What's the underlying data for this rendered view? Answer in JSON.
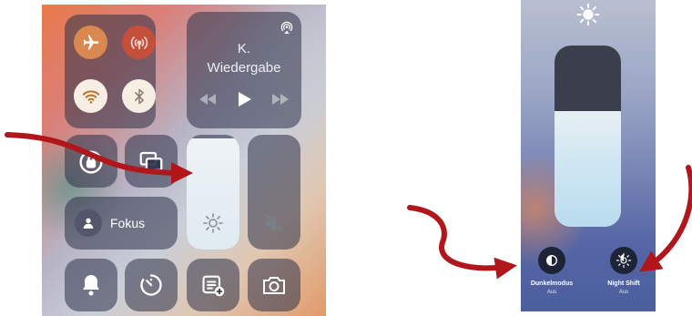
{
  "left_panel": {
    "connectivity": {
      "airplane": "airplane-icon",
      "cellular": "cellular-icon",
      "wifi": "wifi-icon",
      "bluetooth": "bluetooth-icon"
    },
    "media": {
      "title_line1": "K.",
      "title_line2": "Wiedergabe",
      "airplay_icon": "airplay-icon"
    },
    "focus_label": "Fokus",
    "brightness_level": 0.97,
    "volume_level": 0.0
  },
  "right_panel": {
    "brightness_level": 0.64,
    "dark_mode": {
      "label": "Dunkelmodus",
      "status": "Aus"
    },
    "night_shift": {
      "label": "Night Shift",
      "status": "Aus"
    }
  },
  "colors": {
    "arrow": "#b0161a",
    "accent_orange": "#d98850"
  }
}
